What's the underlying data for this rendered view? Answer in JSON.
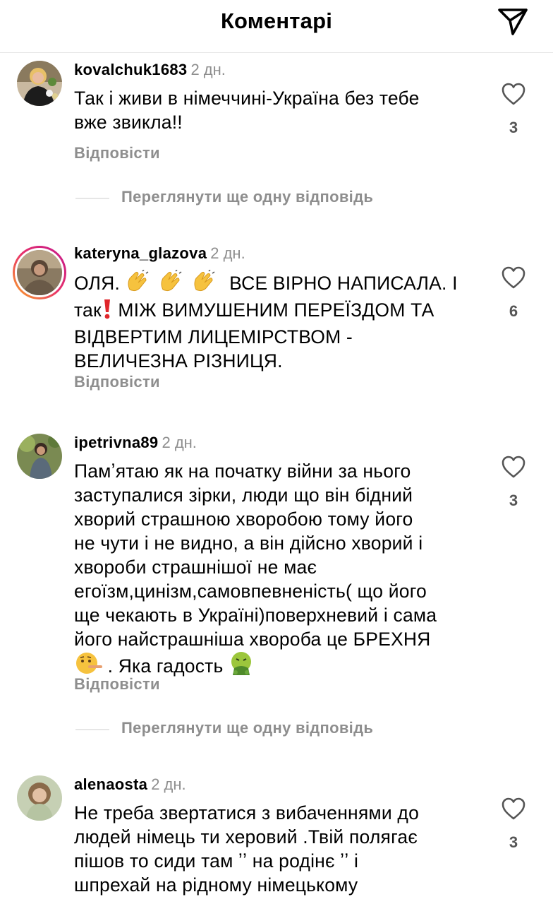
{
  "header": {
    "title": "Коментарі",
    "share_icon": "paper-plane-icon"
  },
  "reply_label": "Відповісти",
  "view_more_label": "Переглянути ще одну відповідь",
  "comments": [
    {
      "username": "kovalchuk1683",
      "time": "2 дн.",
      "text": "Так і живи в німеччині-Україна без тебе\nвже звикла!!",
      "likes": "3"
    },
    {
      "username": "kateryna_glazova",
      "time": "2 дн.",
      "text_parts": [
        "ОЛЯ. ",
        " ВСЕ ВІРНО НАПИСАЛА. І",
        "так",
        "  МІЖ ВИМУШЕНИМ ПЕРЕЇЗДОМ ТА\nВІДВЕРТИМ ЛИЦЕМІРСТВОМ -\nВЕЛИЧЕЗНА РІЗНИЦЯ."
      ],
      "likes": "6"
    },
    {
      "username": "ipetrivna89",
      "time": "2 дн.",
      "text": "Памʼятаю як на початку війни за нього\nзаступалися зірки, люди що він бідний\nхворий страшною хворобою тому його\nне чути і не видно, а він дійсно хворий і\nхвороби страшнішої не має\nегоїзм,цинізм,самовпевненість( що його\nще чекають в Україні)поверхневий і сама\nйого найстрашніша хвороба це БРЕХНЯ",
      "text_end": " . Яка гадость ",
      "likes": "3"
    },
    {
      "username": "alenaosta",
      "time": "2 дн.",
      "text": "Не треба звертатися з вибаченнями до\nлюдей німець ти херовий .Твій полягає\nпішов то сиди там ʼʼ на родінє ʼʼ і\nшпрехай на рідному німецькому",
      "likes": "3"
    }
  ],
  "colors": {
    "secondary_text": "#8e8e8e",
    "divider": "#e6e6e6",
    "story_ring_start": "#f9a825",
    "story_ring_end": "#d81b9c"
  }
}
